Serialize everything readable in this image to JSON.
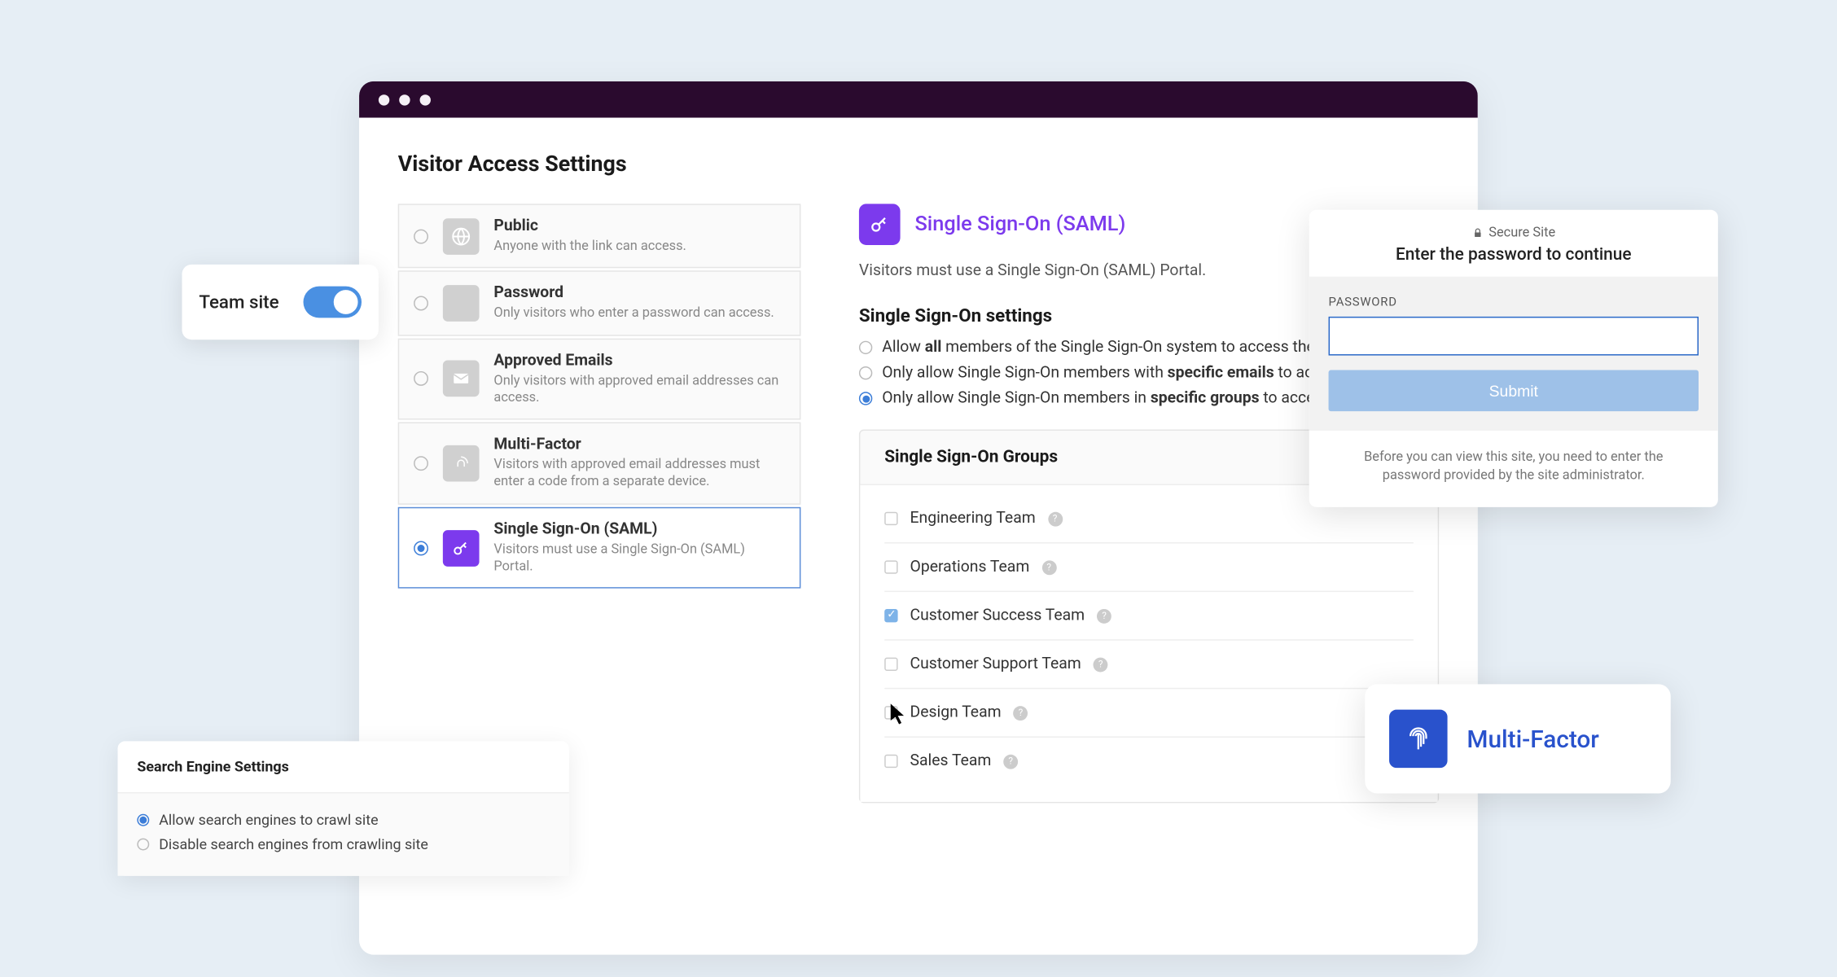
{
  "page_title": "Visitor Access Settings",
  "options": [
    {
      "title": "Public",
      "desc": "Anyone with the link can access.",
      "icon": "globe"
    },
    {
      "title": "Password",
      "desc": "Only visitors who enter a password can access.",
      "icon": "asterisk"
    },
    {
      "title": "Approved Emails",
      "desc": "Only visitors with approved email addresses can access.",
      "icon": "envelope"
    },
    {
      "title": "Multi-Factor",
      "desc": "Visitors with approved email addresses must enter a code from a separate device.",
      "icon": "fingerprint"
    },
    {
      "title": "Single Sign-On (SAML)",
      "desc": "Visitors must use a Single Sign-On (SAML) Portal.",
      "icon": "key"
    }
  ],
  "detail": {
    "title": "Single Sign-On (SAML)",
    "desc": "Visitors must use a Single Sign-On (SAML) Portal.",
    "settings_title": "Single Sign-On settings",
    "radio_all_pre": "Allow ",
    "radio_all_bold": "all",
    "radio_all_post": " members of the Single Sign-On system to access the s",
    "radio_emails_pre": "Only allow Single Sign-On members with ",
    "radio_emails_bold": "specific emails",
    "radio_emails_post": " to acc",
    "radio_groups_pre": "Only allow Single Sign-On members in ",
    "radio_groups_bold": "specific groups",
    "radio_groups_post": " to acces",
    "groups_title": "Single Sign-On Groups",
    "groups": [
      {
        "name": "Engineering Team",
        "checked": false
      },
      {
        "name": "Operations Team",
        "checked": false
      },
      {
        "name": "Customer Success Team",
        "checked": true
      },
      {
        "name": "Customer Support Team",
        "checked": false
      },
      {
        "name": "Design Team",
        "checked": false
      },
      {
        "name": "Sales Team",
        "checked": false
      }
    ]
  },
  "team_site": {
    "label": "Team site",
    "enabled": true
  },
  "search": {
    "title": "Search Engine Settings",
    "allow": "Allow search engines to crawl site",
    "disable": "Disable search engines from crawling site"
  },
  "password_panel": {
    "secure": "Secure Site",
    "title": "Enter the password to continue",
    "label": "PASSWORD",
    "submit": "Submit",
    "note": "Before you can view this site, you need to enter the password provided by the site administrator."
  },
  "multi_factor": {
    "label": "Multi-Factor"
  }
}
